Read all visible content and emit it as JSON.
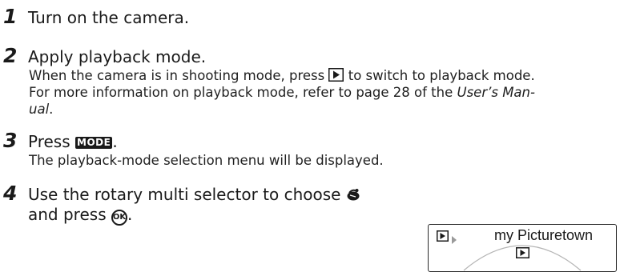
{
  "steps": [
    {
      "number": "1",
      "title": "Turn on the camera."
    },
    {
      "number": "2",
      "title": "Apply playback mode.",
      "body_line1_pre": "When the camera is in shooting mode, press",
      "body_line1_post": "to switch to playback mode.",
      "body_line2_pre": "For more information on playback mode, refer to page 28 of the",
      "body_line2_italic": "User’s Man-",
      "body_line3_italic": "ual",
      "body_line3_post": "."
    },
    {
      "number": "3",
      "title_pre": "Press",
      "mode_key": "MODE",
      "title_post": ".",
      "body": "The playback-mode selection menu will be displayed."
    },
    {
      "number": "4",
      "title_line1": "Use the rotary multi selector to choose",
      "title_line2_pre": "and press",
      "title_line2_post": ".",
      "ok_label": "OK"
    }
  ],
  "lcd": {
    "title": "my Picturetown"
  },
  "icons": {
    "playback": "playback-icon",
    "mode": "mode-button-icon",
    "ok": "ok-button-icon",
    "picturetown": "picturetown-icon",
    "arrow": "arrow-icon"
  }
}
